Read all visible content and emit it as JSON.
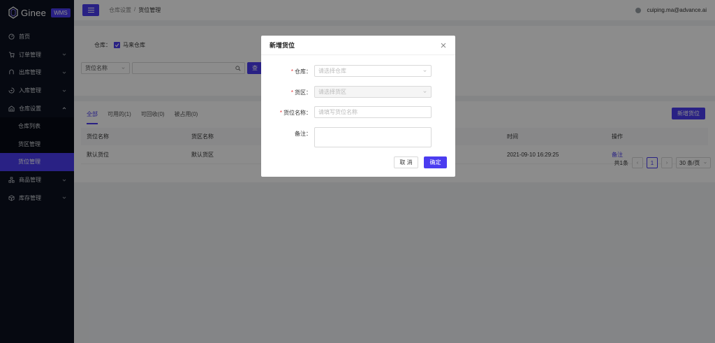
{
  "brand": {
    "name": "Ginee",
    "badge": "WMS"
  },
  "sidebar": {
    "items": [
      {
        "label": "首页",
        "icon": "dashboard-icon"
      },
      {
        "label": "订单管理",
        "icon": "cart-icon"
      },
      {
        "label": "出库管理",
        "icon": "outbound-icon"
      },
      {
        "label": "入库管理",
        "icon": "inbound-icon"
      },
      {
        "label": "仓库设置",
        "icon": "warehouse-icon"
      },
      {
        "label": "商品管理",
        "icon": "product-icon"
      },
      {
        "label": "库存管理",
        "icon": "inventory-icon"
      }
    ],
    "sub_items": [
      {
        "label": "仓库列表"
      },
      {
        "label": "货区管理"
      },
      {
        "label": "货位管理"
      }
    ]
  },
  "header": {
    "breadcrumb_parent": "仓库设置",
    "breadcrumb_sep": "/",
    "breadcrumb_current": "货位管理",
    "user_email": "cuiping.ma@advance.ai"
  },
  "filter": {
    "warehouse_label": "仓库：",
    "warehouse_value": "马来仓库",
    "field_select": "货位名称",
    "search_btn": "查"
  },
  "tabs": [
    {
      "label": "全部"
    },
    {
      "label": "可用的(1)"
    },
    {
      "label": "可回收(0)"
    },
    {
      "label": "被占用(0)"
    }
  ],
  "new_slot_button": "新增货位",
  "table": {
    "headers": [
      "货位名称",
      "货区名称",
      "时间",
      "操作"
    ],
    "rows": [
      {
        "slot": "默认货位",
        "zone": "默认货区",
        "time": "2021-09-10 16:29:25",
        "action": "备注"
      }
    ]
  },
  "pagination": {
    "total": "共1条",
    "page": "1",
    "size": "30 条/页"
  },
  "modal": {
    "title": "新增货位",
    "fields": {
      "warehouse_label": "仓库：",
      "warehouse_placeholder": "请选择仓库",
      "zone_label": "货区：",
      "zone_placeholder": "请选择货区",
      "slot_label": "货位名称：",
      "slot_placeholder": "请填写货位名称",
      "note_label": "备注："
    },
    "required_mark": "*",
    "cancel": "取 消",
    "ok": "确定"
  },
  "colors": {
    "accent": "#4b3cf0",
    "sidebar_bg": "#0b1120"
  }
}
